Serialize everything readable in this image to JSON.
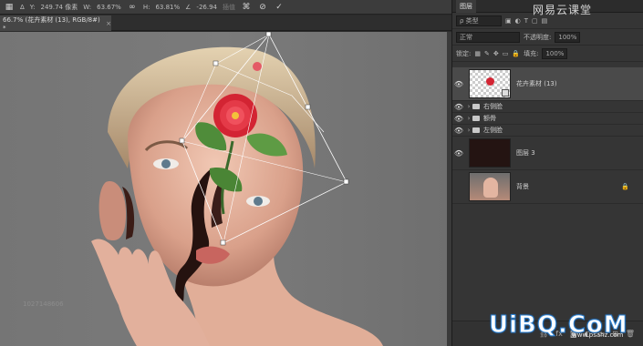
{
  "options_bar": {
    "delta_label": "Δ",
    "y_label": "Y:",
    "y_value": "249.74 像素",
    "w_label": "W:",
    "w_value": "63.67%",
    "link_icon": "link-icon",
    "h_label": "H:",
    "h_value": "63.81%",
    "angle_label": "∠",
    "angle_value": "-26.94",
    "interp_label": "插值",
    "warp_icon": "warp-icon",
    "cancel_icon": "cancel-icon",
    "commit_icon": "commit-icon"
  },
  "document_tab": {
    "title": "66.7% (花卉素材 (13), RGB/8#) *",
    "close": "×"
  },
  "canvas": {
    "id_number": "1027148606"
  },
  "layers_panel": {
    "title": "图层",
    "search_placeholder": "ρ 类型",
    "blend_mode": "正常",
    "opacity_label": "不透明度:",
    "opacity_value": "100%",
    "lock_label": "锁定:",
    "fill_label": "填充:",
    "fill_value": "100%",
    "layers": [
      {
        "name": "花卉素材 (13)",
        "visible": true,
        "selected": true,
        "type": "image"
      },
      {
        "name": "右侧脸",
        "visible": true,
        "selected": false,
        "type": "group"
      },
      {
        "name": "额骨",
        "visible": true,
        "selected": false,
        "type": "group"
      },
      {
        "name": "左侧脸",
        "visible": true,
        "selected": false,
        "type": "group"
      },
      {
        "name": "图层 3",
        "visible": true,
        "selected": false,
        "type": "fill"
      },
      {
        "name": "背景",
        "visible": false,
        "selected": false,
        "type": "background",
        "locked": true
      }
    ],
    "footer_icons": [
      "link-icon",
      "fx-icon",
      "mask-icon",
      "adjust-icon",
      "folder-icon",
      "new-layer-icon",
      "trash-icon"
    ]
  },
  "watermarks": {
    "top_right": "网易云课堂",
    "brand": "UiBQ.CoM",
    "site": "www.psahz.com"
  },
  "colors": {
    "panel_bg": "#353535",
    "selected_row": "#4a4a4a",
    "brand_blue": "#2b7fd0"
  }
}
